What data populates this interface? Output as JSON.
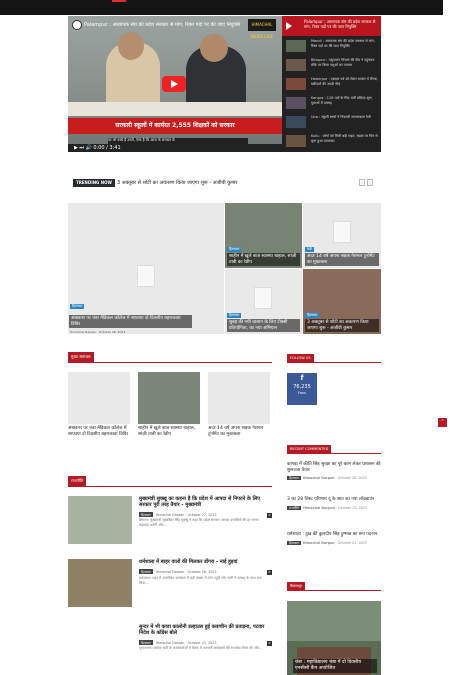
{
  "video": {
    "title": "Palampur : अध्यापक संघ की प्रदेश सरकार से मांग, रिक्त पदों पर की जाए नियुक्ति",
    "channel_badge": "HIMACHAL NEWS LIVE",
    "banner": "सरकारी स्कूलों में कार्यरत 2,555 शिक्षकों को सरकार",
    "subtitle": "पर जो बच्चे हैं उसमें, ऐसा है कि आज के सरकार के",
    "controls": "▶  ⏭  🔊  0:00 / 3:41"
  },
  "playlist": {
    "header": "Palampur : अध्यापक संघ की प्रदेश सरकार से मांग, रिक्त पदों पर की जाए नियुक्ति",
    "count": "1/10",
    "items": [
      {
        "title": "Mandi : अध्यापक संघ की प्रदेश सरकार से मांग, रिक्त पदों पर की जाए नियुक्ति"
      },
      {
        "title": "Bilaspur : पशुपालन विभाग की टीम ने पहुंचकर मौके पर किया पशुओं का उपचार"
      },
      {
        "title": "Hamirpur : दशहरा पर्व को लेकर बाजार में रौनक, खरीदारों की उमड़ी भीड़"
      },
      {
        "title": "Kangra : 128 पदों के लिए भर्ती प्रक्रिया शुरू, युवाओं में उत्साह"
      },
      {
        "title": "Una : स्कूली बच्चों ने निकाली जागरूकता रैली"
      },
      {
        "title": "Kullu : लोगों को मिली बड़ी राहत, सड़क पर फिर से शुरू हुआ यातायात"
      }
    ]
  },
  "trending": {
    "label": "TRENDING NOW",
    "text": "3 अक्तूबर से शोटी का अवतरण किया जाएगा शुरू - अंजीवी कुमार"
  },
  "featured": [
    {
      "category": "हिमाचल",
      "title": "अंबाडनर पर चंबा मेडिकल कॉलेज में साफ़ाया दो दिवसीय बहराकावा विविर",
      "meta": "Himachal Darpan  ·  October 26, 2023"
    },
    {
      "category": "हिमाचल",
      "title": "साहीन में खुले बाज स्वास्थ्य बाहाल, सांज़ी ताबी का रेडीप"
    },
    {
      "category": "मंडी",
      "title": "अदर 14 वर्ष अपना सड़क नेशनल टूर्नामेंट का मुकाबला"
    },
    {
      "category": "हिमाचल",
      "title": "सुबह की नयी चालान के लिए टीक्सी प्रतियोगिता, का नया अभियान"
    },
    {
      "category": "हिमाचल",
      "title": "3 अक्तूबर से शोटी का अवतरण किया जाएगा शुरू - अंजीवी कुमार"
    }
  ],
  "sections": {
    "mukhya": "मुख्य समाचार",
    "rajniti": "राजनीति",
    "follow": "FOLLOW US",
    "recent": "RECENT COMMENTED",
    "shimla": "बिलासपुर"
  },
  "mukhya_cards": [
    {
      "title": "अंबाडनर पर चंबा मेडिकल कॉलेज में साफ़ाया दो दिवसीय बहराकावा विविर"
    },
    {
      "title": "साहीन में खुले बाज स्वास्थ्य बाहाल, सांज़ी ताबी का रेडीप"
    },
    {
      "title": "अदर 14 वर्ष अपना सड़क नेशनल टूर्नामेंट का मुकाबला"
    }
  ],
  "rajniti_items": [
    {
      "title": "मुख्यमंत्री सुक्खू का कहना है कि प्रदेश में आपदा से निपटने के लिए सरकार पूरी तरह तैयार - मुख्यमंत्री",
      "category": "हिमाचल",
      "author": "Himachal Darpan",
      "date": "October 27, 2023",
      "excerpt": "शिमला। मुख्यमंत्री सुखविंदर सिंह सुक्खू ने कहा कि प्रदेश सरकार आपदा प्रभावितों की हर संभव सहायता करेगी और...",
      "count": "0"
    },
    {
      "title": "धर्मशाला में बाहर वालों की मिलकर डोंगरा - नाई हुइयां",
      "category": "हिमाचल",
      "author": "Himachal Darpan",
      "date": "October 26, 2023",
      "excerpt": "धर्मशाला। शहर में आयोजित कार्यक्रम में बड़ी संख्या में लोग पहुंचे और सभी ने उत्साह के साथ भाग लिया...",
      "count": "0"
    },
    {
      "title": "सुन्दर में भी कावा कालोनी डल्हाउस हुई कवाचीन की प्रताड़ना, पटवार निदेश के कोंग्रेस बोले",
      "category": "हिमाचल",
      "author": "Himachal Darpan",
      "date": "October 25, 2023",
      "excerpt": "सुन्दरनगर। कांग्रेस पार्टी के कार्यकर्ताओं ने बैठक में आगामी कार्यक्रमों की रूपरेखा तैयार की और...",
      "count": "0"
    }
  ],
  "follow": {
    "count": "76,235",
    "label": "Fans"
  },
  "recent_comments": [
    {
      "title": "कांगड़ा में कीर्ति सिंह सुरक्षा का पूरे काम लेकर प्रशासन की सुसज्जा तैयार",
      "category": "हिमाचल",
      "author": "Himachal Darpan",
      "date": "October 26, 2023",
      "count": "0"
    },
    {
      "title": "3 का 28 लिस्ट परिणाम दू के सात का नया लॉक्डाउन",
      "category": "राजनीति",
      "author": "Himachal Darpan",
      "date": "October 25, 2023",
      "count": "0"
    },
    {
      "title": "धर्मशाला : दुख की कुलदीप सिंह ट्रूम्भाड का रूप पदनान",
      "category": "हिमाचल",
      "author": "Himachal Darpan",
      "date": "October 24, 2023",
      "count": "0"
    }
  ],
  "bilaspur_story": {
    "title": "चंबा : महाविद्यालय चंबा में दो दिवसीय एनसीसी कैंप आयोजित",
    "category": "हिमाचल"
  },
  "colors": {
    "brand": "#b51b24",
    "top": "#141414"
  }
}
